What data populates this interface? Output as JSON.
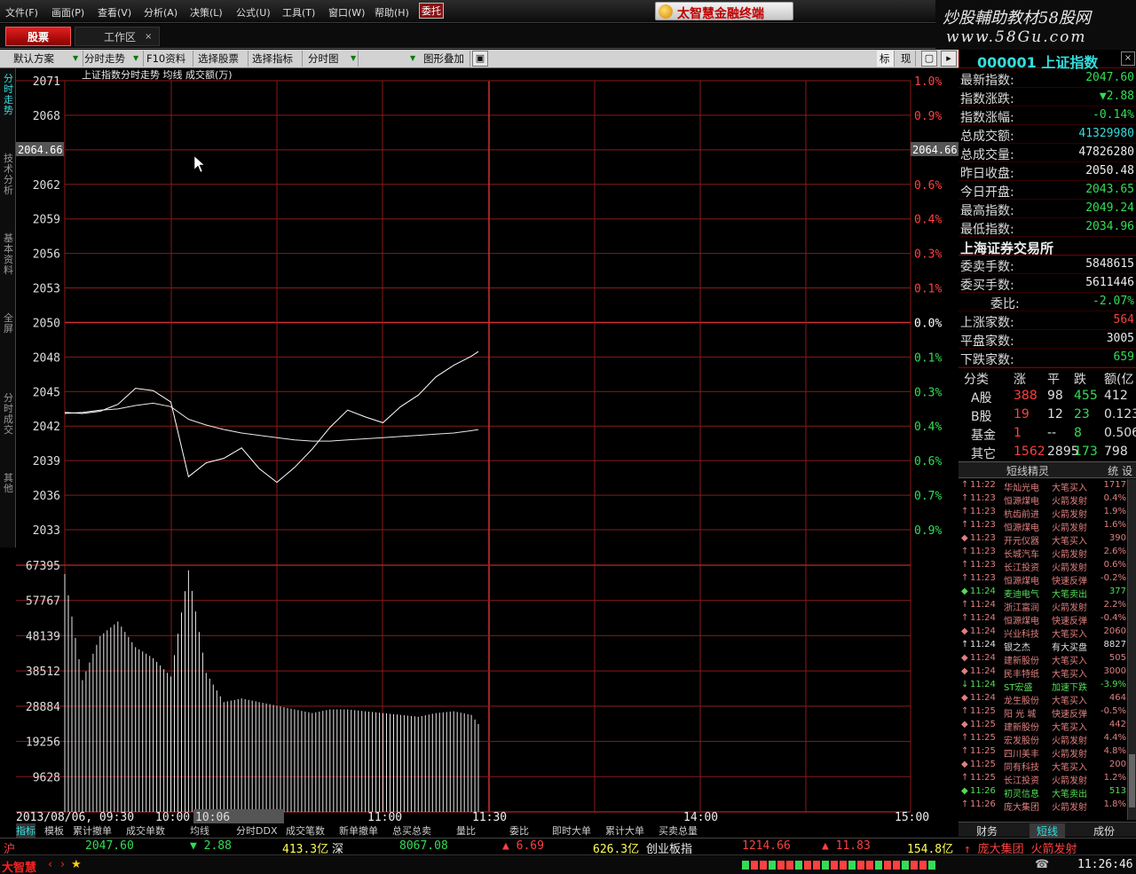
{
  "menu": [
    "文件(F)",
    "画面(P)",
    "查看(V)",
    "分析(A)",
    "决策(L)",
    "公式(U)",
    "工具(T)",
    "窗口(W)",
    "帮助(H)"
  ],
  "entrust": "委托",
  "brand": "太智慧金融终端",
  "watermark": {
    "line1": "炒股輔助教材58股网",
    "line2": "www.58Gu.com"
  },
  "tabs": {
    "active": "股票",
    "workspace": "工作区",
    "close_icon": "×"
  },
  "toolbar": {
    "scheme": "默认方案",
    "trend": "分时走势",
    "f10": "F10资料",
    "select_stock": "选择股票",
    "select_indicator": "选择指标",
    "chart_type": "分时图",
    "overlay": "图形叠加",
    "lock_icon": "lock",
    "biao": "标",
    "xian": "现"
  },
  "sidebar": [
    "分时走势",
    "技术分析",
    "基本资料",
    "全屏",
    "分时成交",
    "其他"
  ],
  "chart": {
    "title": "上证指数分时走势 均线 成交额(万)",
    "current_label": "2064.66",
    "price_ticks": [
      "2071",
      "2068",
      "2065",
      "2062",
      "2059",
      "2056",
      "2053",
      "2050",
      "2048",
      "2045",
      "2042",
      "2039",
      "2036",
      "2033"
    ],
    "pct_ticks": [
      "1.0%",
      "0.9%",
      "0.7%",
      "0.6%",
      "0.4%",
      "0.3%",
      "0.1%",
      "0.0%",
      "0.1%",
      "0.3%",
      "0.4%",
      "0.6%",
      "0.7%",
      "0.9%"
    ],
    "vol_ticks": [
      "67395",
      "57767",
      "48139",
      "38512",
      "28884",
      "19256",
      "9628"
    ],
    "time_ticks": [
      "2013/08/06, 09:30",
      "10:00",
      "10:06",
      "11:00",
      "11:30",
      "14:00",
      "15:00"
    ],
    "cursor_time": "10:06"
  },
  "chart_data": {
    "type": "line",
    "title": "上证指数分时走势",
    "x": [
      "09:30",
      "09:35",
      "09:40",
      "09:45",
      "09:50",
      "09:55",
      "10:00",
      "10:05",
      "10:10",
      "10:15",
      "10:20",
      "10:25",
      "10:30",
      "10:35",
      "10:40",
      "10:45",
      "10:50",
      "10:55",
      "11:00",
      "11:05",
      "11:10",
      "11:15",
      "11:20",
      "11:25",
      "11:27"
    ],
    "series": [
      {
        "name": "",
        "values": [
          2042.7,
          2042.6,
          2042.8,
          2043.4,
          2044.8,
          2044.6,
          2043.6,
          2037.1,
          2038.3,
          2038.7,
          2039.6,
          2037.8,
          2036.6,
          2037.9,
          2039.5,
          2041.4,
          2042.9,
          2042.3,
          2041.8,
          2043.2,
          2044.2,
          2045.8,
          2046.8,
          2047.6,
          2048.0
        ]
      },
      {
        "name": "均线",
        "values": [
          2042.6,
          2042.7,
          2042.9,
          2043.0,
          2043.3,
          2043.5,
          2043.2,
          2042.1,
          2041.6,
          2041.2,
          2040.9,
          2040.7,
          2040.5,
          2040.3,
          2040.2,
          2040.2,
          2040.3,
          2040.4,
          2040.5,
          2040.6,
          2040.7,
          2040.8,
          2040.9,
          2041.1,
          2041.2
        ]
      },
      {
        "name": "成交额(万)",
        "values": [
          65000,
          36000,
          48000,
          52000,
          45000,
          42000,
          37000,
          66000,
          38000,
          30000,
          31000,
          30000,
          29000,
          28000,
          27000,
          28000,
          28000,
          27500,
          27000,
          26500,
          26000,
          27000,
          27500,
          26500,
          24000
        ]
      }
    ],
    "ylim": [
      2031.7,
      2071.6
    ],
    "vol_ylim": [
      0,
      67395
    ],
    "grid": true
  },
  "quote": {
    "code": "000001 上证指数",
    "rows": [
      {
        "k": "最新指数:",
        "v": "2047.60",
        "c": "#33dd55"
      },
      {
        "k": "指数涨跌:",
        "v": "▼2.88",
        "c": "#33dd55"
      },
      {
        "k": "指数涨幅:",
        "v": "-0.14%",
        "c": "#33dd55"
      },
      {
        "k": "总成交额:",
        "v": "41329980",
        "c": "#33dddd"
      },
      {
        "k": "总成交量:",
        "v": "47826280",
        "c": "#eeeeee"
      },
      {
        "k": "昨日收盘:",
        "v": "2050.48",
        "c": "#eeeeee"
      },
      {
        "k": "今日开盘:",
        "v": "2043.65",
        "c": "#33dd55"
      },
      {
        "k": "最高指数:",
        "v": "2049.24",
        "c": "#33dd55"
      },
      {
        "k": "最低指数:",
        "v": "2034.96",
        "c": "#33dd55"
      }
    ],
    "exchange": "上海证券交易所",
    "rows2": [
      {
        "k": "委卖手数:",
        "v": "5848615",
        "c": "#eeeeee"
      },
      {
        "k": "委买手数:",
        "v": "5611446",
        "c": "#eeeeee"
      },
      {
        "k": "委比:",
        "v": "-2.07%",
        "c": "#33dd55"
      },
      {
        "k": "上涨家数:",
        "v": "564",
        "c": "#ff4040"
      },
      {
        "k": "平盘家数:",
        "v": "3005",
        "c": "#eeeeee"
      },
      {
        "k": "下跌家数:",
        "v": "659",
        "c": "#33dd55"
      }
    ]
  },
  "classify": {
    "headers": [
      "分类",
      "涨",
      "平",
      "跌",
      "额(亿"
    ],
    "rows": [
      [
        "A股",
        "388",
        "98",
        "455",
        "412"
      ],
      [
        "B股",
        "19",
        "12",
        "23",
        "0.123"
      ],
      [
        "基金",
        "1",
        "--",
        "8",
        "0.506"
      ],
      [
        "其它",
        "1562",
        "2895",
        "173",
        "798"
      ]
    ]
  },
  "sprite": {
    "title": "短线精灵",
    "settings": "统 设",
    "rows": [
      {
        "m": "↑",
        "t": "11:22",
        "n": "华灿光电",
        "e": "大笔买入",
        "v": "1717",
        "c": "#e08080"
      },
      {
        "m": "↑",
        "t": "11:23",
        "n": "恒源煤电",
        "e": "火箭发射",
        "v": "0.4%",
        "c": "#e08080"
      },
      {
        "m": "↑",
        "t": "11:23",
        "n": "杭齿前进",
        "e": "火箭发射",
        "v": "1.9%",
        "c": "#e08080"
      },
      {
        "m": "↑",
        "t": "11:23",
        "n": "恒源煤电",
        "e": "火箭发射",
        "v": "1.6%",
        "c": "#e08080"
      },
      {
        "m": "◆",
        "t": "11:23",
        "n": "开元仪器",
        "e": "大笔买入",
        "v": "390",
        "c": "#e08080"
      },
      {
        "m": "↑",
        "t": "11:23",
        "n": "长城汽车",
        "e": "火箭发射",
        "v": "2.6%",
        "c": "#e08080"
      },
      {
        "m": "↑",
        "t": "11:23",
        "n": "长江投资",
        "e": "火箭发射",
        "v": "0.6%",
        "c": "#e08080"
      },
      {
        "m": "↑",
        "t": "11:23",
        "n": "恒源煤电",
        "e": "快速反弹",
        "v": "-0.2%",
        "c": "#e08080"
      },
      {
        "m": "◆",
        "t": "11:24",
        "n": "麦迪电气",
        "e": "大笔卖出",
        "v": "377",
        "c": "#55dd55"
      },
      {
        "m": "↑",
        "t": "11:24",
        "n": "浙江富润",
        "e": "火箭发射",
        "v": "2.2%",
        "c": "#e08080"
      },
      {
        "m": "↑",
        "t": "11:24",
        "n": "恒源煤电",
        "e": "快速反弹",
        "v": "-0.4%",
        "c": "#e08080"
      },
      {
        "m": "◆",
        "t": "11:24",
        "n": "兴业科技",
        "e": "大笔买入",
        "v": "2060",
        "c": "#e08080"
      },
      {
        "m": "↑",
        "t": "11:24",
        "n": "银之杰",
        "e": "有大买盘",
        "v": "8827",
        "c": "#e0e0e0"
      },
      {
        "m": "◆",
        "t": "11:24",
        "n": "建新股份",
        "e": "大笔买入",
        "v": "505",
        "c": "#e08080"
      },
      {
        "m": "◆",
        "t": "11:24",
        "n": "民丰特纸",
        "e": "大笔买入",
        "v": "3000",
        "c": "#e08080"
      },
      {
        "m": "↓",
        "t": "11:24",
        "n": "ST宏盛",
        "e": "加速下跌",
        "v": "-3.9%",
        "c": "#55dd55"
      },
      {
        "m": "◆",
        "t": "11:24",
        "n": "龙生股份",
        "e": "大笔买入",
        "v": "464",
        "c": "#e08080"
      },
      {
        "m": "↑",
        "t": "11:25",
        "n": "阳 光 城",
        "e": "快速反弹",
        "v": "-0.5%",
        "c": "#e08080"
      },
      {
        "m": "◆",
        "t": "11:25",
        "n": "建新股份",
        "e": "大笔买入",
        "v": "442",
        "c": "#e08080"
      },
      {
        "m": "↑",
        "t": "11:25",
        "n": "宏发股份",
        "e": "火箭发射",
        "v": "4.4%",
        "c": "#e08080"
      },
      {
        "m": "↑",
        "t": "11:25",
        "n": "四川美丰",
        "e": "火箭发射",
        "v": "4.8%",
        "c": "#e08080"
      },
      {
        "m": "◆",
        "t": "11:25",
        "n": "同有科技",
        "e": "大笔买入",
        "v": "200",
        "c": "#e08080"
      },
      {
        "m": "↑",
        "t": "11:25",
        "n": "长江投资",
        "e": "火箭发射",
        "v": "1.2%",
        "c": "#e08080"
      },
      {
        "m": "◆",
        "t": "11:26",
        "n": "初灵信息",
        "e": "大笔卖出",
        "v": "513",
        "c": "#55dd55"
      },
      {
        "m": "↑",
        "t": "11:26",
        "n": "庞大集团",
        "e": "火箭发射",
        "v": "1.8%",
        "c": "#e08080"
      }
    ],
    "tabs": [
      "财务",
      "短线",
      "成份"
    ]
  },
  "bottom_tabs": [
    "指标",
    "模板",
    "累计撤单",
    "成交单数",
    "均线",
    "分时DDX",
    "成交笔数",
    "新单撤单",
    "总买总卖",
    "量比",
    "委比",
    "即时大单",
    "累计大单",
    "买卖总量"
  ],
  "status": {
    "sh_label": "沪",
    "sh_price": "2047.60",
    "sh_chg": "▼ 2.88",
    "sh_amt": "413.3亿",
    "sz_label": "深",
    "sz_price": "8067.08",
    "sz_chg": "▲ 6.69",
    "sz_amt": "626.3亿",
    "cy_label": "创业板指",
    "cy_price": "1214.66",
    "cy_chg": "▲ 11.83",
    "cy_amt": "154.8亿",
    "alert": "↑ 庞大集团 火箭发射",
    "time": "11:26:46",
    "brand": "大智慧"
  }
}
